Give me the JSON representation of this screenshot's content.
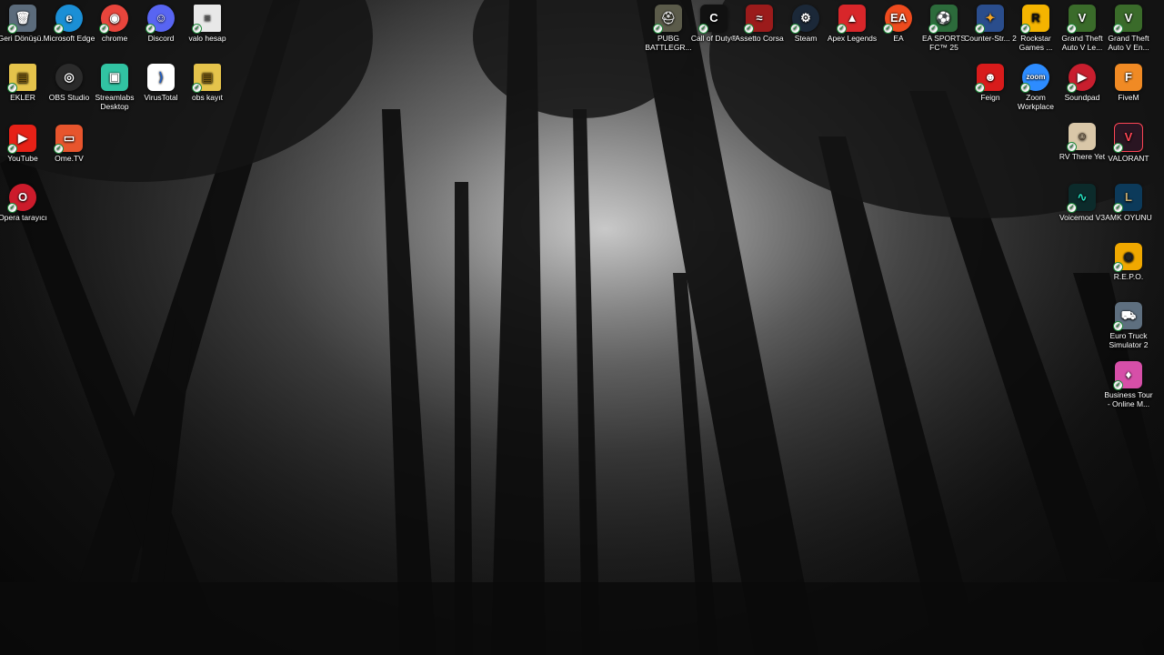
{
  "desktop": {
    "icons": [
      {
        "label": "Geri Dönüşü...",
        "glyph": "🗑",
        "color": "#5b6b7b",
        "icon": "recycle-bin-icon"
      },
      {
        "label": "Microsoft Edge",
        "glyph": "e",
        "color": "#1b8fd6",
        "icon": "edge-icon"
      },
      {
        "label": "chrome",
        "glyph": "◉",
        "color": "#e8453c",
        "icon": "chrome-icon"
      },
      {
        "label": "Discord",
        "glyph": "☺",
        "color": "#5865f2",
        "icon": "discord-icon"
      },
      {
        "label": "valo hesap",
        "glyph": "≡",
        "color": "#e8e8e8",
        "icon": "text-file-icon"
      },
      {
        "label": "EKLER",
        "glyph": "▤",
        "color": "#e5c34b",
        "icon": "folder-icon"
      },
      {
        "label": "OBS Studio",
        "glyph": "◎",
        "color": "#2b2b2b",
        "icon": "obs-icon"
      },
      {
        "label": "Streamlabs Desktop",
        "glyph": "▣",
        "color": "#31c3a2",
        "icon": "streamlabs-icon"
      },
      {
        "label": "VirusTotal",
        "glyph": "⟩",
        "color": "#1f5ec7",
        "icon": "virustotal-icon"
      },
      {
        "label": "obs kayıt",
        "glyph": "▤",
        "color": "#e5c34b",
        "icon": "folder-icon"
      },
      {
        "label": "YouTube",
        "glyph": "▶",
        "color": "#e62117",
        "icon": "youtube-icon"
      },
      {
        "label": "Ome.TV",
        "glyph": "▭",
        "color": "#e7552d",
        "icon": "ometv-icon"
      },
      {
        "label": "Opera tarayıcı",
        "glyph": "O",
        "color": "#cc1b2b",
        "icon": "opera-icon"
      },
      {
        "label": "PUBG BATTLEGR...",
        "glyph": "⛑",
        "color": "#5b5b4a",
        "icon": "pubg-icon"
      },
      {
        "label": "Call of Duty®",
        "glyph": "C",
        "color": "#111111",
        "icon": "call-of-duty-icon"
      },
      {
        "label": "Assetto Corsa",
        "glyph": "≈",
        "color": "#9b1b1b",
        "icon": "assetto-corsa-icon"
      },
      {
        "label": "Steam",
        "glyph": "⚙",
        "color": "#1b2838",
        "icon": "steam-icon"
      },
      {
        "label": "Apex Legends",
        "glyph": "▲",
        "color": "#d8262a",
        "icon": "apex-legends-icon"
      },
      {
        "label": "EA",
        "glyph": "EA",
        "color": "#ee4b1e",
        "icon": "ea-icon"
      },
      {
        "label": "EA SPORTS FC™ 25",
        "glyph": "⚽",
        "color": "#2c6b3b",
        "icon": "ea-sports-fc-icon"
      },
      {
        "label": "Counter-Str... 2",
        "glyph": "✦",
        "color": "#2a4d8c",
        "icon": "counter-strike-icon"
      },
      {
        "label": "Rockstar Games ...",
        "glyph": "R",
        "color": "#f4b400",
        "icon": "rockstar-icon"
      },
      {
        "label": "Grand Theft Auto V Le...",
        "glyph": "V",
        "color": "#3a6b2a",
        "icon": "gta-v-icon"
      },
      {
        "label": "Grand Theft Auto V En...",
        "glyph": "V",
        "color": "#3a6b2a",
        "icon": "gta-v-icon"
      },
      {
        "label": "Feign",
        "glyph": "☻",
        "color": "#d81b1b",
        "icon": "feign-icon"
      },
      {
        "label": "Zoom Workplace",
        "glyph": "zoom",
        "color": "#2d8cff",
        "icon": "zoom-icon"
      },
      {
        "label": "Soundpad",
        "glyph": "▶",
        "color": "#c81e2e",
        "icon": "soundpad-icon"
      },
      {
        "label": "FiveM",
        "glyph": "F",
        "color": "#f08a24",
        "icon": "fivem-icon"
      },
      {
        "label": "RV There Yet",
        "glyph": "☺",
        "color": "#d9c7a8",
        "icon": "rv-there-yet-icon"
      },
      {
        "label": "VALORANT",
        "glyph": "V",
        "color": "#2a1522",
        "icon": "valorant-icon"
      },
      {
        "label": "Voicemod V3",
        "glyph": "∿",
        "color": "#0c2b2b",
        "icon": "voicemod-icon"
      },
      {
        "label": "AMK OYUNU",
        "glyph": "L",
        "color": "#0c3a5a",
        "icon": "league-icon"
      },
      {
        "label": "R.E.P.O.",
        "glyph": "◉",
        "color": "#f0a800",
        "icon": "repo-icon"
      },
      {
        "label": "Euro Truck Simulator 2",
        "glyph": "⛟",
        "color": "#5e6f7f",
        "icon": "euro-truck-icon"
      },
      {
        "label": "Business Tour - Online M...",
        "glyph": "♦",
        "color": "#d64fa8",
        "icon": "business-tour-icon"
      }
    ]
  }
}
